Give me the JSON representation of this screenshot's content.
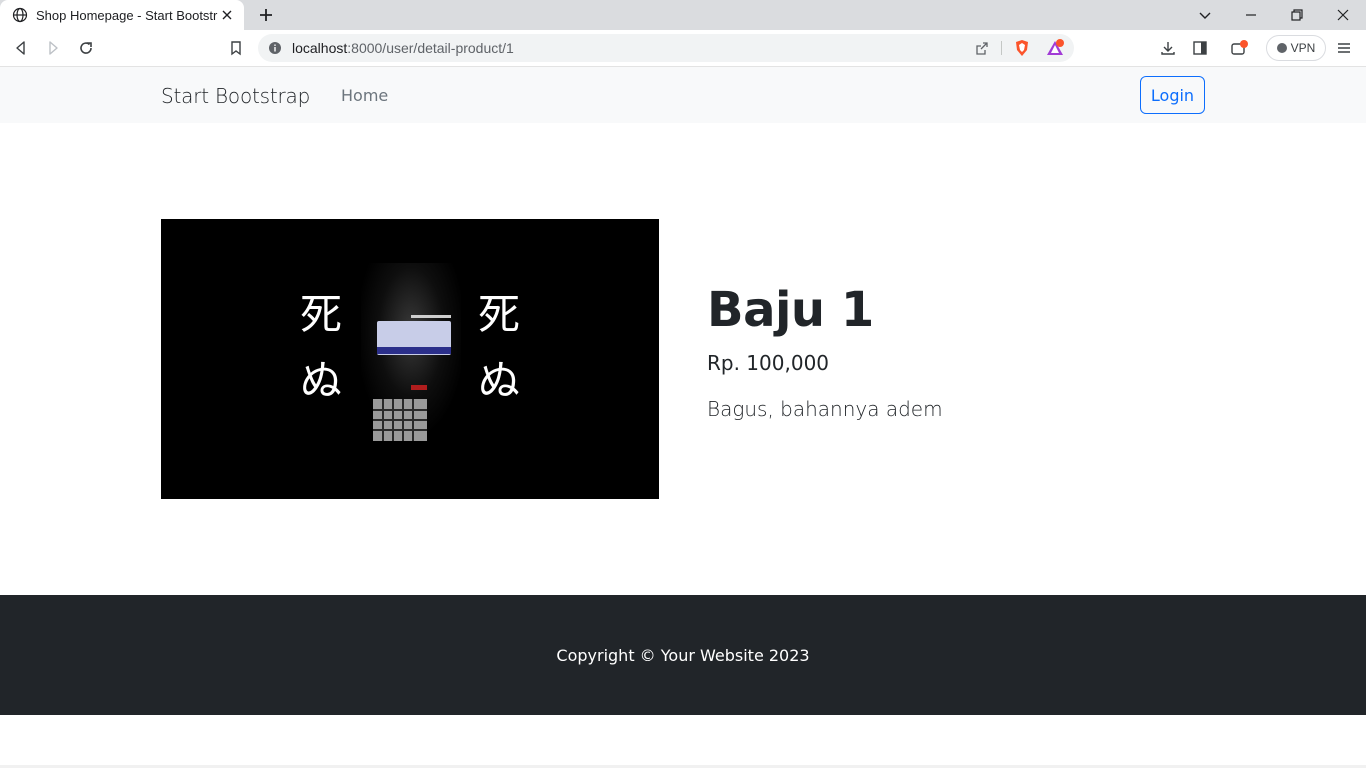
{
  "browser": {
    "tab_title": "Shop Homepage - Start Bootstrap",
    "url_host": "localhost",
    "url_path": ":8000/user/detail-product/1",
    "vpn_label": "VPN"
  },
  "navbar": {
    "brand": "Start Bootstrap",
    "links": [
      "Home"
    ],
    "login_label": "Login"
  },
  "product": {
    "image_text_left": [
      "死",
      "ぬ"
    ],
    "image_text_right": [
      "死",
      "ぬ"
    ],
    "title": "Baju 1",
    "price": "Rp. 100,000",
    "description": "Bagus, bahannya adem"
  },
  "footer": {
    "copyright": "Copyright © Your Website 2023"
  },
  "colors": {
    "primary": "#0d6efd",
    "navbar_bg": "#f8f9fa",
    "footer_bg": "#212529",
    "text": "#212529"
  }
}
